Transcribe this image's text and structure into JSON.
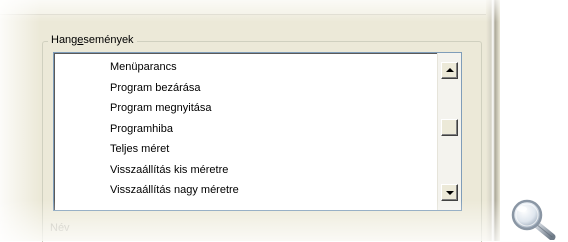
{
  "groupbox": {
    "legend_prefix": "Hang",
    "legend_accesskey": "e",
    "legend_suffix": "semények"
  },
  "events_list": {
    "items": [
      "Menüparancs",
      "Program bezárása",
      "Program megnyitása",
      "Programhiba",
      "Teljes méret",
      "Visszaállítás kis méretre",
      "Visszaállítás nagy méretre"
    ],
    "scroll_position": 0.45
  },
  "below_label": "Név",
  "icons": {
    "magnifier": "magnifier-icon",
    "scroll_up": "scroll-up-arrow-icon",
    "scroll_down": "scroll-down-arrow-icon"
  },
  "colors": {
    "dialog_bg": "#ece9d8",
    "list_border": "#7f9db9"
  }
}
